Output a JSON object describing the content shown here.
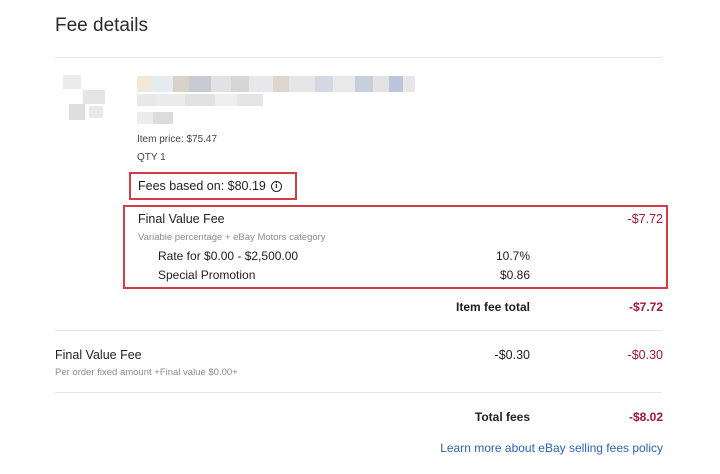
{
  "header": {
    "title": "Fee details"
  },
  "item": {
    "price_text": "Item price: $75.47",
    "qty_text": "QTY 1"
  },
  "fees_based_on": {
    "label": "Fees based on: $80.19",
    "icon": "info-icon"
  },
  "final_value_fee": {
    "title": "Final Value Fee",
    "amount": "-$7.72",
    "subtitle": "Variable percentage + eBay Motors category",
    "rate_label": "Rate for $0.00 - $2,500.00",
    "rate_value": "10.7%",
    "promo_label": "Special Promotion",
    "promo_value": "$0.86"
  },
  "item_fee_total": {
    "label": "Item fee total",
    "value": "-$7.72"
  },
  "order_fee": {
    "title": "Final Value Fee",
    "subtitle": "Per order fixed amount +Final value $0.00+",
    "mid_value": "-$0.30",
    "value": "-$0.30"
  },
  "total_fees": {
    "label": "Total fees",
    "value": "-$8.02"
  },
  "footer": {
    "link_text": "Learn more about eBay selling fees policy"
  },
  "colors": {
    "accent_red": "#d53a47",
    "fee_value": "#a3163b",
    "link": "#2a62b8"
  }
}
